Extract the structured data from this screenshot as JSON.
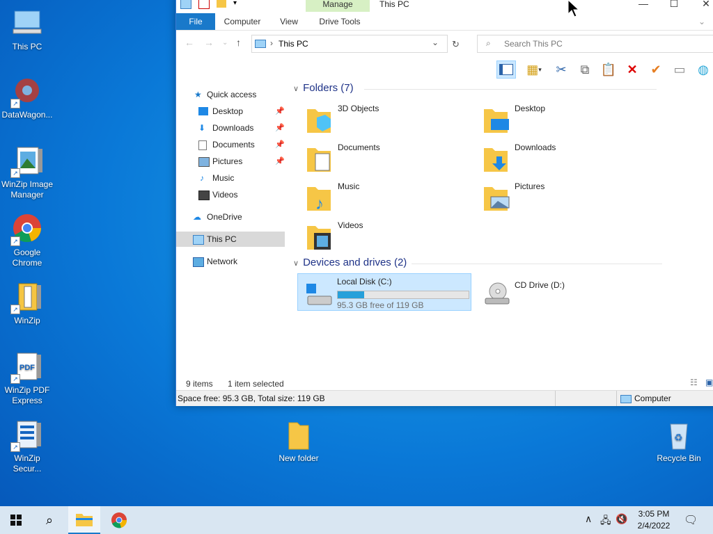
{
  "desktop": {
    "icons": [
      {
        "label": "This PC",
        "icon": "this-pc-icon"
      },
      {
        "label": "DataWagon...",
        "icon": "datawagon-icon"
      },
      {
        "label": "WinZip Image Manager",
        "icon": "winzip-image-manager-icon"
      },
      {
        "label": "Google Chrome",
        "icon": "chrome-icon"
      },
      {
        "label": "WinZip",
        "icon": "winzip-icon"
      },
      {
        "label": "WinZip PDF Express",
        "icon": "winzip-pdf-icon"
      },
      {
        "label": "WinZip Secur...",
        "icon": "winzip-secure-icon"
      },
      {
        "label": "New folder",
        "icon": "folder-icon"
      },
      {
        "label": "Recycle Bin",
        "icon": "recycle-bin-icon"
      }
    ]
  },
  "window": {
    "title": "This PC",
    "context_tab": "Manage",
    "tabs": [
      "File",
      "Computer",
      "View",
      "Drive Tools"
    ],
    "address": "This PC",
    "search_placeholder": "Search This PC"
  },
  "nav": {
    "quick_access": "Quick access",
    "items": [
      {
        "label": "Desktop",
        "pinned": true
      },
      {
        "label": "Downloads",
        "pinned": true
      },
      {
        "label": "Documents",
        "pinned": true
      },
      {
        "label": "Pictures",
        "pinned": true
      },
      {
        "label": "Music",
        "pinned": false
      },
      {
        "label": "Videos",
        "pinned": false
      }
    ],
    "onedrive": "OneDrive",
    "this_pc": "This PC",
    "network": "Network"
  },
  "content": {
    "folders_header": "Folders (7)",
    "folders": [
      "3D Objects",
      "Desktop",
      "Documents",
      "Downloads",
      "Music",
      "Pictures",
      "Videos"
    ],
    "drives_header": "Devices and drives (2)",
    "drives": [
      {
        "name": "Local Disk (C:)",
        "free_text": "95.3 GB free of 119 GB",
        "used_fraction": 0.2
      },
      {
        "name": "CD Drive (D:)"
      }
    ]
  },
  "status": {
    "items": "9 items",
    "selected": "1 item selected",
    "details": "Space free: 95.3 GB, Total size: 119 GB",
    "location": "Computer"
  },
  "taskbar": {
    "time": "3:05 PM",
    "date": "2/4/2022"
  }
}
